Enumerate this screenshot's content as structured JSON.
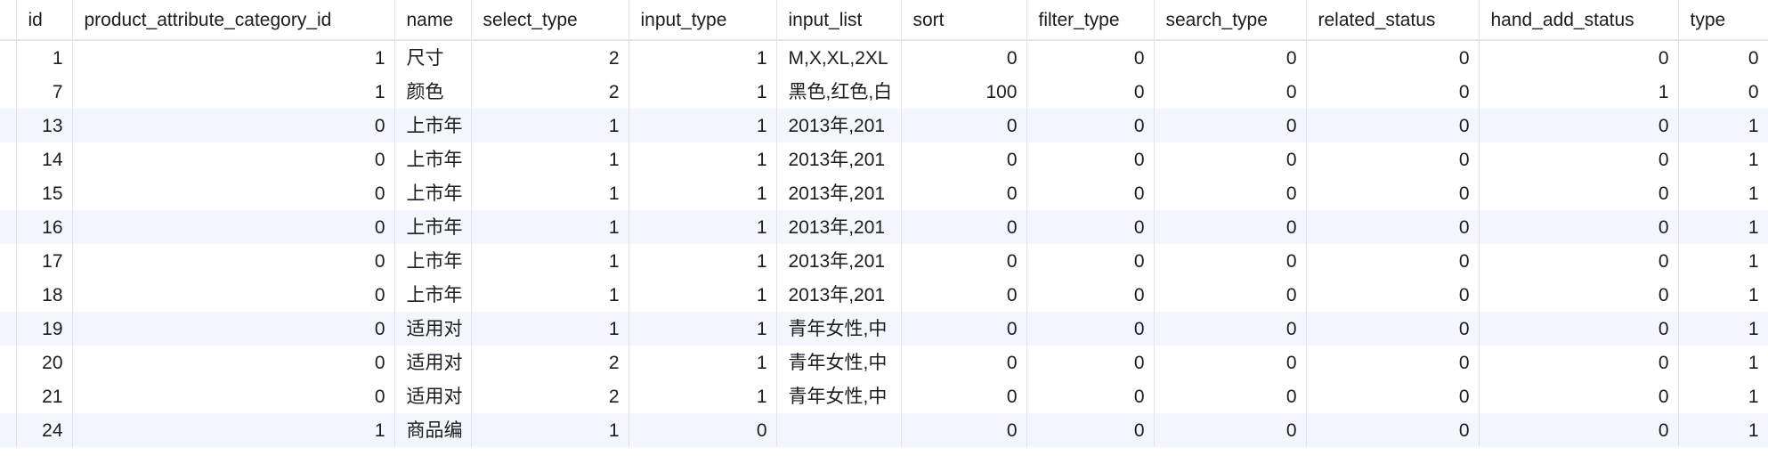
{
  "table": {
    "columns": [
      "id",
      "product_attribute_category_id",
      "name",
      "select_type",
      "input_type",
      "input_list",
      "sort",
      "filter_type",
      "search_type",
      "related_status",
      "hand_add_status",
      "type"
    ],
    "rows": [
      [
        "1",
        "1",
        "尺寸",
        "2",
        "1",
        "M,X,XL,2XL",
        "0",
        "0",
        "0",
        "0",
        "0",
        "0"
      ],
      [
        "7",
        "1",
        "颜色",
        "2",
        "1",
        "黑色,红色,白",
        "100",
        "0",
        "0",
        "0",
        "1",
        "0"
      ],
      [
        "13",
        "0",
        "上市年",
        "1",
        "1",
        "2013年,201",
        "0",
        "0",
        "0",
        "0",
        "0",
        "1"
      ],
      [
        "14",
        "0",
        "上市年",
        "1",
        "1",
        "2013年,201",
        "0",
        "0",
        "0",
        "0",
        "0",
        "1"
      ],
      [
        "15",
        "0",
        "上市年",
        "1",
        "1",
        "2013年,201",
        "0",
        "0",
        "0",
        "0",
        "0",
        "1"
      ],
      [
        "16",
        "0",
        "上市年",
        "1",
        "1",
        "2013年,201",
        "0",
        "0",
        "0",
        "0",
        "0",
        "1"
      ],
      [
        "17",
        "0",
        "上市年",
        "1",
        "1",
        "2013年,201",
        "0",
        "0",
        "0",
        "0",
        "0",
        "1"
      ],
      [
        "18",
        "0",
        "上市年",
        "1",
        "1",
        "2013年,201",
        "0",
        "0",
        "0",
        "0",
        "0",
        "1"
      ],
      [
        "19",
        "0",
        "适用对",
        "1",
        "1",
        "青年女性,中",
        "0",
        "0",
        "0",
        "0",
        "0",
        "1"
      ],
      [
        "20",
        "0",
        "适用对",
        "2",
        "1",
        "青年女性,中",
        "0",
        "0",
        "0",
        "0",
        "0",
        "1"
      ],
      [
        "21",
        "0",
        "适用对",
        "2",
        "1",
        "青年女性,中",
        "0",
        "0",
        "0",
        "0",
        "0",
        "1"
      ],
      [
        "24",
        "1",
        "商品编",
        "1",
        "0",
        "",
        "0",
        "0",
        "0",
        "0",
        "0",
        "1"
      ]
    ]
  },
  "colors": {
    "alt_row_background": "#f3f7fd",
    "grid_line": "#e4e4e4",
    "text": "#1d1d1f"
  }
}
